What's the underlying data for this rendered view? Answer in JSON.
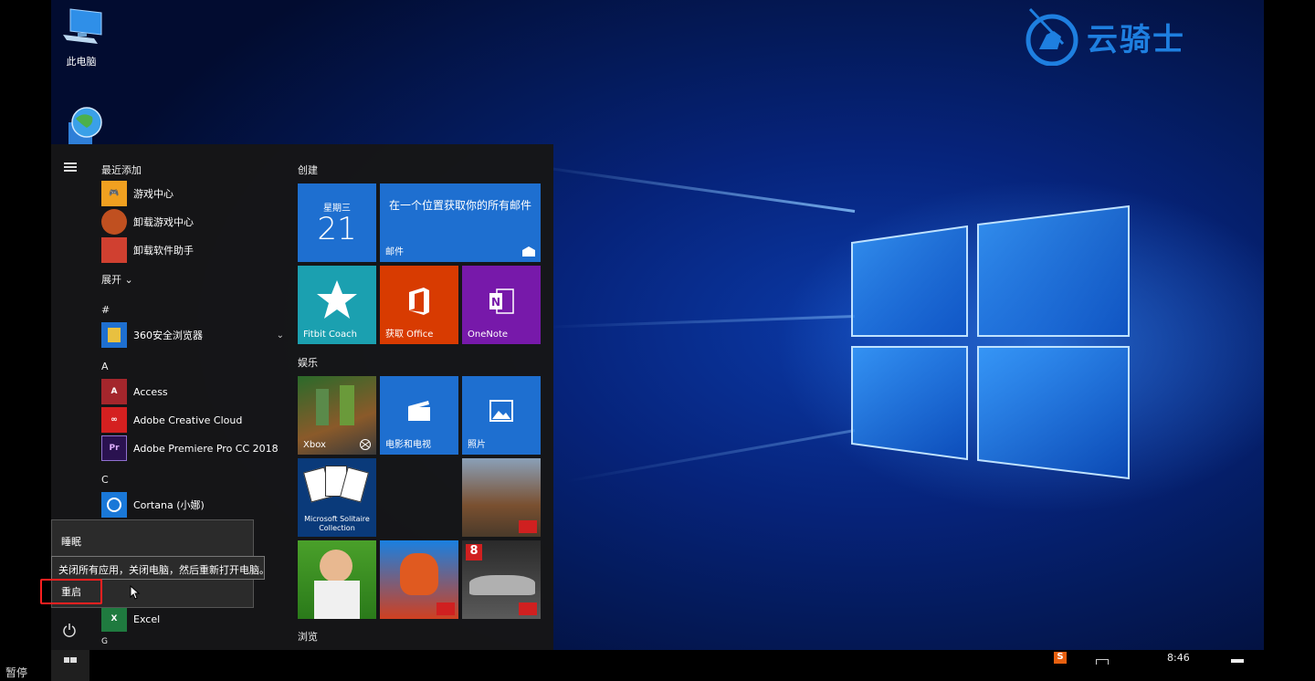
{
  "desktop": {
    "icons": [
      {
        "label": "此电脑",
        "icon": "computer-icon"
      },
      {
        "label": "",
        "icon": "network-globe-icon"
      }
    ]
  },
  "brand": {
    "text": "云骑士",
    "color": "#1e7fe0",
    "icon": "knight-logo-icon"
  },
  "start_menu": {
    "recent_header": "最近添加",
    "recent_apps": [
      {
        "label": "游戏中心",
        "icon": "game-center-icon",
        "color": "#f0a020"
      },
      {
        "label": "卸载游戏中心",
        "icon": "uninstall-game-icon",
        "color": "#c05020"
      },
      {
        "label": "卸载软件助手",
        "icon": "uninstall-helper-icon",
        "color": "#d04030"
      }
    ],
    "expand_label": "展开",
    "sections": [
      {
        "letter": "#",
        "apps": [
          {
            "label": "360安全浏览器",
            "icon": "folder-icon",
            "color": "#e8c040",
            "has_chevron": true
          }
        ]
      },
      {
        "letter": "A",
        "apps": [
          {
            "label": "Access",
            "icon": "access-icon",
            "color": "#a4262c"
          },
          {
            "label": "Adobe Creative Cloud",
            "icon": "creative-cloud-icon",
            "color": "#d42020"
          },
          {
            "label": "Adobe Premiere Pro CC 2018",
            "icon": "premiere-icon",
            "color": "#2a1250"
          }
        ]
      },
      {
        "letter": "C",
        "apps": [
          {
            "label": "Cortana (小娜)",
            "icon": "cortana-icon",
            "color": "#1a78d8"
          }
        ]
      }
    ],
    "excel": {
      "label": "Excel",
      "icon": "excel-icon",
      "color": "#1f7a3f"
    },
    "next_letter": "G"
  },
  "tiles": {
    "group_create": "创建",
    "group_entertainment": "娱乐",
    "group_browse": "浏览",
    "calendar": {
      "weekday": "星期三",
      "day": "21"
    },
    "mail": {
      "headline": "在一个位置获取你的所有邮件",
      "caption": "邮件"
    },
    "fitbit": {
      "caption": "Fitbit Coach"
    },
    "office": {
      "caption": "获取 Office"
    },
    "onenote": {
      "caption": "OneNote"
    },
    "xbox": {
      "caption": "Xbox"
    },
    "movies": {
      "caption": "电影和电视"
    },
    "photos": {
      "caption": "照片"
    },
    "solitaire": {
      "caption": "Microsoft Solitaire Collection"
    },
    "colors": {
      "blue": "#1e6fd0",
      "teal": "#1ba0b0",
      "red": "#d83b01",
      "purple": "#7719aa"
    }
  },
  "power_menu": {
    "sleep": "睡眠",
    "tooltip": "关闭所有应用，关闭电脑，然后重新打开电脑。",
    "restart": "重启"
  },
  "taskbar": {
    "time": "8:46"
  },
  "player": {
    "pause_label": "暂停"
  }
}
